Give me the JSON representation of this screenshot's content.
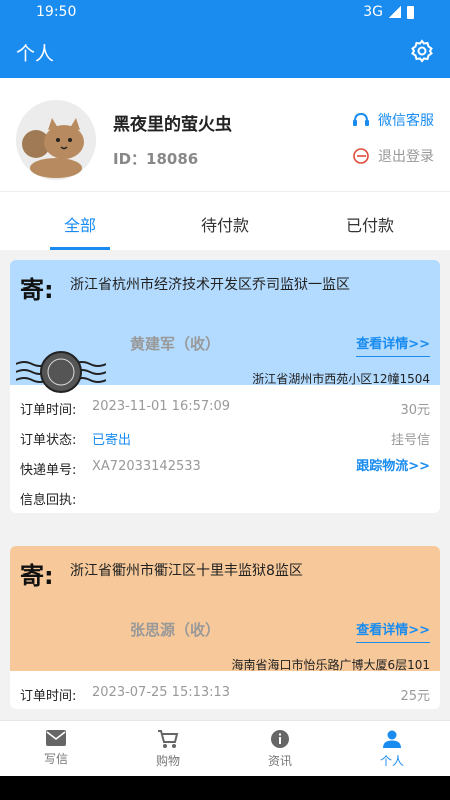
{
  "status": {
    "time": "19:50",
    "network": "3G"
  },
  "header": {
    "title": "个人"
  },
  "profile": {
    "nickname": "黑夜里的萤火虫",
    "id_label": "ID：",
    "id_value": "18086",
    "service_label": "微信客服",
    "logout_label": "退出登录"
  },
  "tabs": [
    {
      "label": "全部",
      "active": true
    },
    {
      "label": "待付款",
      "active": false
    },
    {
      "label": "已付款",
      "active": false
    }
  ],
  "orders": [
    {
      "ji": "寄:",
      "from_address": "浙江省杭州市经济技术开发区乔司监狱一监区",
      "recipient": "黄建军（收）",
      "detail_link": "查看详情>>",
      "to_address": "浙江省湖州市西苑小区12幢1504",
      "order_time_label": "订单时间:",
      "order_time": "2023-11-01 16:57:09",
      "price": "30元",
      "status_label": "订单状态:",
      "status": "已寄出",
      "mail_type": "挂号信",
      "tracking_label": "快递单号:",
      "tracking": "XA72033142533",
      "track_link": "跟踪物流>>",
      "receipt_label": "信息回执:",
      "color": "#b3dbff"
    },
    {
      "ji": "寄:",
      "from_address": "浙江省衢州市衢江区十里丰监狱8监区",
      "recipient": "张思源（收）",
      "detail_link": "查看详情>>",
      "to_address": "海南省海口市怡乐路广博大厦6层101",
      "order_time_label": "订单时间:",
      "order_time": "2023-07-25 15:13:13",
      "price": "25元",
      "color": "#f7c99a"
    }
  ],
  "bottom_nav": [
    {
      "label": "写信",
      "icon": "mail-icon"
    },
    {
      "label": "购物",
      "icon": "cart-icon"
    },
    {
      "label": "资讯",
      "icon": "info-icon"
    },
    {
      "label": "个人",
      "icon": "person-icon",
      "active": true
    }
  ],
  "colors": {
    "primary": "#1a8cf0"
  }
}
